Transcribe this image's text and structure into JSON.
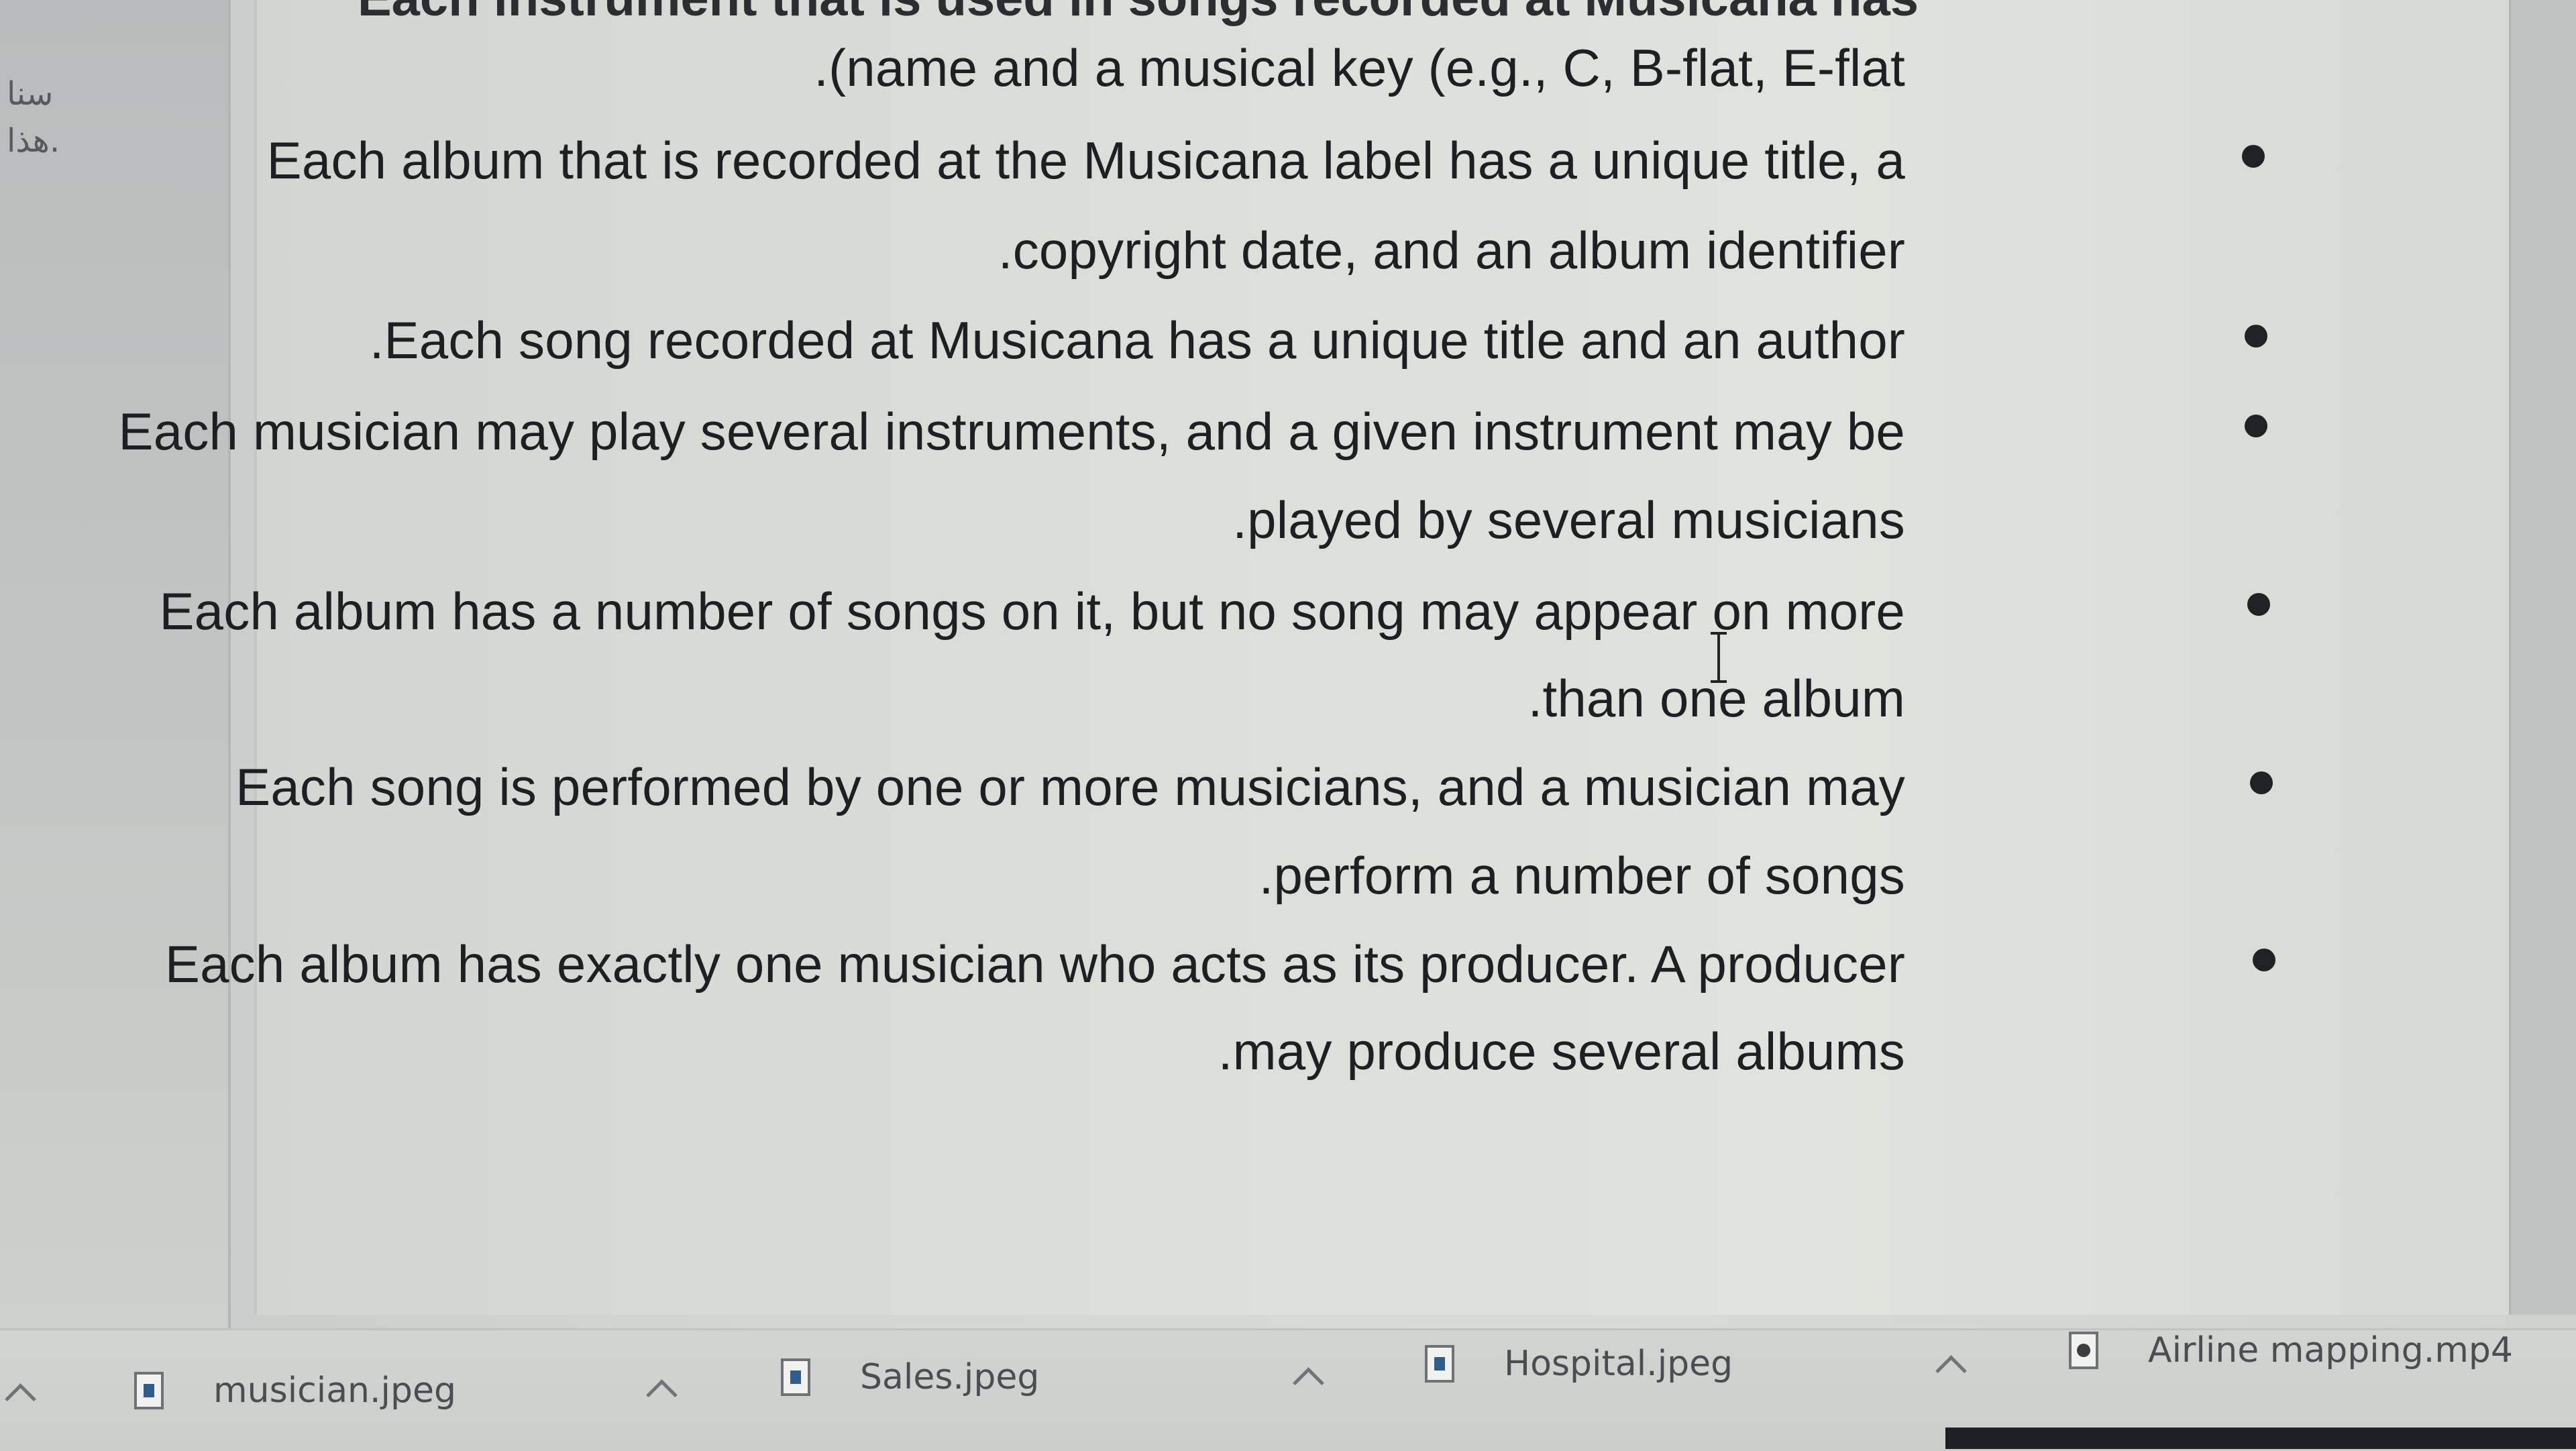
{
  "document": {
    "top_line_partial": "Each instrument that is used in songs recorded at Musicana has",
    "lines": [
      {
        "text": ".(name and a musical key (e.g., C, B-flat, E-flat",
        "bullet": false
      },
      {
        "text": "Each album that is recorded at the Musicana label has a unique title, a",
        "bullet": true
      },
      {
        "text": ".copyright date, and an album identifier",
        "bullet": false
      },
      {
        "text": ".Each song recorded at Musicana has a unique title and an author",
        "bullet": true
      },
      {
        "text": "Each musician may play several instruments, and a given instrument may be",
        "bullet": true
      },
      {
        "text": ".played by several musicians",
        "bullet": false
      },
      {
        "text": "Each album has a number of songs on it, but no song may appear on more",
        "bullet": true
      },
      {
        "text": ".than one album",
        "bullet": false
      },
      {
        "text": "Each song is performed by one or more musicians, and a musician may",
        "bullet": true
      },
      {
        "text": ".perform a number of songs",
        "bullet": false
      },
      {
        "text": "Each album has exactly one musician who acts as its producer. A producer",
        "bullet": true
      },
      {
        "text": ".may produce several albums",
        "bullet": false
      }
    ]
  },
  "sidebar": {
    "text1": "سنا",
    "text2": ".هذا"
  },
  "downloads": [
    {
      "name": "musician.jpeg",
      "icon": "image-file-icon"
    },
    {
      "name": "Sales.jpeg",
      "icon": "image-file-icon"
    },
    {
      "name": "Hospital.jpeg",
      "icon": "image-file-icon"
    },
    {
      "name": "Airline mapping.mp4",
      "icon": "video-file-icon"
    }
  ]
}
